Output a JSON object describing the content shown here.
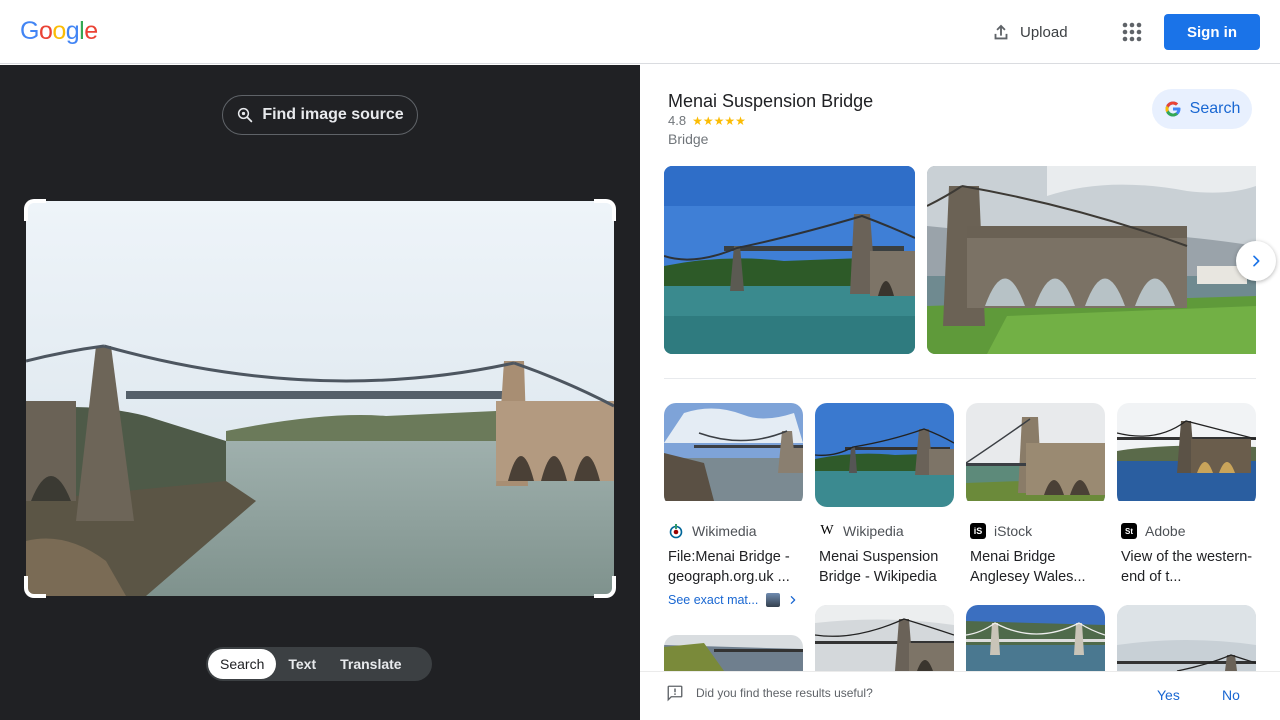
{
  "header": {
    "logo_letters": [
      {
        "ch": "G",
        "color": "#4285f4"
      },
      {
        "ch": "o",
        "color": "#ea4335"
      },
      {
        "ch": "o",
        "color": "#fbbc05"
      },
      {
        "ch": "g",
        "color": "#4285f4"
      },
      {
        "ch": "l",
        "color": "#34a853"
      },
      {
        "ch": "e",
        "color": "#ea4335"
      }
    ],
    "upload_label": "Upload",
    "upload_icon": "upload-icon",
    "apps_icon": "apps-grid-icon",
    "signin_label": "Sign in"
  },
  "left": {
    "find_source_label": "Find image source",
    "find_source_icon": "lens-search-icon",
    "tabs": [
      {
        "label": "Search",
        "active": true
      },
      {
        "label": "Text",
        "active": false
      },
      {
        "label": "Translate",
        "active": false
      }
    ]
  },
  "entity": {
    "title": "Menai Suspension Bridge",
    "rating": "4.8",
    "stars": "★★★★★",
    "type": "Bridge",
    "search_label": "Search"
  },
  "results": [
    {
      "source": "Wikimedia",
      "title": "File:Menai Bridge - geograph.org.uk ...",
      "favicon": "wikimedia-icon"
    },
    {
      "source": "Wikipedia",
      "title": "Menai Suspension Bridge - Wikipedia",
      "favicon": "wikipedia-icon",
      "favicon_text": "W"
    },
    {
      "source": "iStock",
      "title": "Menai Bridge Anglesey Wales...",
      "favicon": "istock-icon",
      "favicon_text": "iS"
    },
    {
      "source": "Adobe",
      "title": "View of the western-end of t...",
      "favicon": "adobe-stock-icon",
      "favicon_text": "St"
    }
  ],
  "exact_matches_label": "See exact mat...",
  "feedback": {
    "question": "Did you find these results useful?",
    "yes": "Yes",
    "no": "No"
  },
  "colors": {
    "accent": "#1a73e8",
    "dark_panel": "#202124",
    "star": "#fbbc04"
  }
}
